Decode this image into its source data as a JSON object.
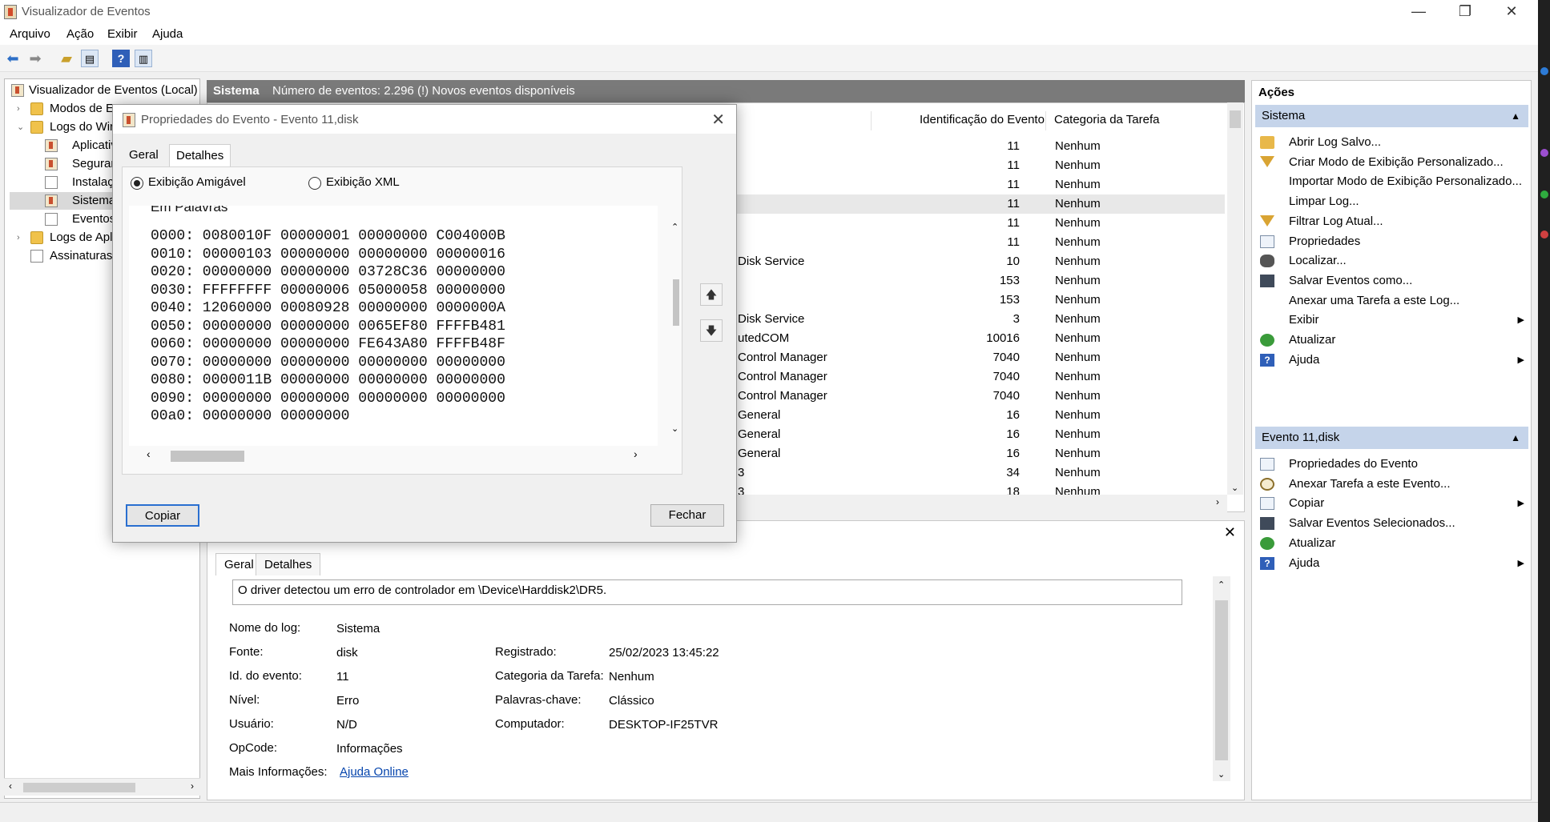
{
  "window": {
    "title": "Visualizador de Eventos",
    "minimize": "—",
    "maximize": "❐",
    "close": "✕"
  },
  "menu": [
    "Arquivo",
    "Ação",
    "Exibir",
    "Ajuda"
  ],
  "tree": {
    "root": "Visualizador de Eventos (Local)",
    "items": [
      {
        "label": "Modos de E"
      },
      {
        "label": "Logs do Wir"
      },
      {
        "label": "Aplicativ"
      },
      {
        "label": "Seguran"
      },
      {
        "label": "Instalaçã"
      },
      {
        "label": "Sistema"
      },
      {
        "label": "Eventos"
      },
      {
        "label": "Logs de Apli"
      },
      {
        "label": "Assinaturas"
      }
    ]
  },
  "list": {
    "name": "Sistema",
    "info": "Número de eventos: 2.296 (!) Novos eventos disponíveis",
    "columns": {
      "event_id": "Identificação do Evento",
      "category": "Categoria da Tarefa"
    },
    "rows": [
      {
        "source": "",
        "id": "11",
        "cat": "Nenhum"
      },
      {
        "source": "",
        "id": "11",
        "cat": "Nenhum"
      },
      {
        "source": "",
        "id": "11",
        "cat": "Nenhum"
      },
      {
        "source": "",
        "id": "11",
        "cat": "Nenhum"
      },
      {
        "source": "",
        "id": "11",
        "cat": "Nenhum"
      },
      {
        "source": "",
        "id": "11",
        "cat": "Nenhum"
      },
      {
        "source": "Disk Service",
        "id": "10",
        "cat": "Nenhum"
      },
      {
        "source": "",
        "id": "153",
        "cat": "Nenhum"
      },
      {
        "source": "",
        "id": "153",
        "cat": "Nenhum"
      },
      {
        "source": "Disk Service",
        "id": "3",
        "cat": "Nenhum"
      },
      {
        "source": "utedCOM",
        "id": "10016",
        "cat": "Nenhum"
      },
      {
        "source": "Control Manager",
        "id": "7040",
        "cat": "Nenhum"
      },
      {
        "source": "Control Manager",
        "id": "7040",
        "cat": "Nenhum"
      },
      {
        "source": "Control Manager",
        "id": "7040",
        "cat": "Nenhum"
      },
      {
        "source": "General",
        "id": "16",
        "cat": "Nenhum"
      },
      {
        "source": "General",
        "id": "16",
        "cat": "Nenhum"
      },
      {
        "source": "General",
        "id": "16",
        "cat": "Nenhum"
      },
      {
        "source": "3",
        "id": "34",
        "cat": "Nenhum"
      },
      {
        "source": "3",
        "id": "18",
        "cat": "Nenhum"
      }
    ]
  },
  "details": {
    "tabs": [
      "Geral",
      "Detalhes"
    ],
    "message": "O driver detectou um erro de controlador em \\Device\\Harddisk2\\DR5.",
    "fields": {
      "log_label": "Nome do log:",
      "log_value": "Sistema",
      "source_label": "Fonte:",
      "source_value": "disk",
      "eventid_label": "Id. do evento:",
      "eventid_value": "11",
      "level_label": "Nível:",
      "level_value": "Erro",
      "user_label": "Usuário:",
      "user_value": "N/D",
      "opcode_label": "OpCode:",
      "opcode_value": "Informações",
      "more_label": "Mais Informações:",
      "more_value": "Ajuda Online",
      "logged_label": "Registrado:",
      "logged_value": "25/02/2023 13:45:22",
      "task_label": "Categoria da Tarefa:",
      "task_value": "Nenhum",
      "keywords_label": "Palavras-chave:",
      "keywords_value": "Clássico",
      "computer_label": "Computador:",
      "computer_value": "DESKTOP-IF25TVR"
    }
  },
  "actions": {
    "header": "Ações",
    "section1": "Sistema",
    "items1": [
      {
        "label": "Abrir Log Salvo...",
        "icon": "open-folder-icon"
      },
      {
        "label": "Criar Modo de Exibição Personalizado...",
        "icon": "filter-icon"
      },
      {
        "label": "Importar Modo de Exibição Personalizado...",
        "icon": ""
      },
      {
        "label": "Limpar Log...",
        "icon": ""
      },
      {
        "label": "Filtrar Log Atual...",
        "icon": "filter-icon"
      },
      {
        "label": "Propriedades",
        "icon": "properties-icon"
      },
      {
        "label": "Localizar...",
        "icon": "binoculars-icon"
      },
      {
        "label": "Salvar Eventos como...",
        "icon": "save-icon"
      },
      {
        "label": "Anexar uma Tarefa a este Log...",
        "icon": ""
      },
      {
        "label": "Exibir",
        "icon": "",
        "submenu": true
      },
      {
        "label": "Atualizar",
        "icon": "refresh-icon"
      },
      {
        "label": "Ajuda",
        "icon": "help-icon",
        "submenu": true
      }
    ],
    "section2": "Evento 11,disk",
    "items2": [
      {
        "label": "Propriedades do Evento",
        "icon": "properties-icon"
      },
      {
        "label": "Anexar Tarefa a este Evento...",
        "icon": "task-icon"
      },
      {
        "label": "Copiar",
        "icon": "copy-icon",
        "submenu": true
      },
      {
        "label": "Salvar Eventos Selecionados...",
        "icon": "save-icon"
      },
      {
        "label": "Atualizar",
        "icon": "refresh-icon"
      },
      {
        "label": "Ajuda",
        "icon": "help-icon",
        "submenu": true
      }
    ]
  },
  "dialog": {
    "title": "Propriedades do Evento - Evento 11,disk",
    "tabs": [
      "Geral",
      "Detalhes"
    ],
    "radio_friendly": "Exibição Amigável",
    "radio_xml": "Exibição XML",
    "section_heading": "Em Palavras",
    "hex_lines": [
      "0000: 0080010F 00000001 00000000 C004000B",
      "0010: 00000103 00000000 00000000 00000016",
      "0020: 00000000 00000000 03728C36 00000000",
      "0030: FFFFFFFF 00000006 05000058 00000000",
      "0040: 12060000 00080928 00000000 0000000A",
      "0050: 00000000 00000000 0065EF80 FFFFB481",
      "0060: 00000000 00000000 FE643A80 FFFFB48F",
      "0070: 00000000 00000000 00000000 00000000",
      "0080: 0000011B 00000000 00000000 00000000",
      "0090: 00000000 00000000 00000000 00000000",
      "00a0: 00000000 00000000"
    ],
    "copy_button": "Copiar",
    "close_button": "Fechar"
  }
}
